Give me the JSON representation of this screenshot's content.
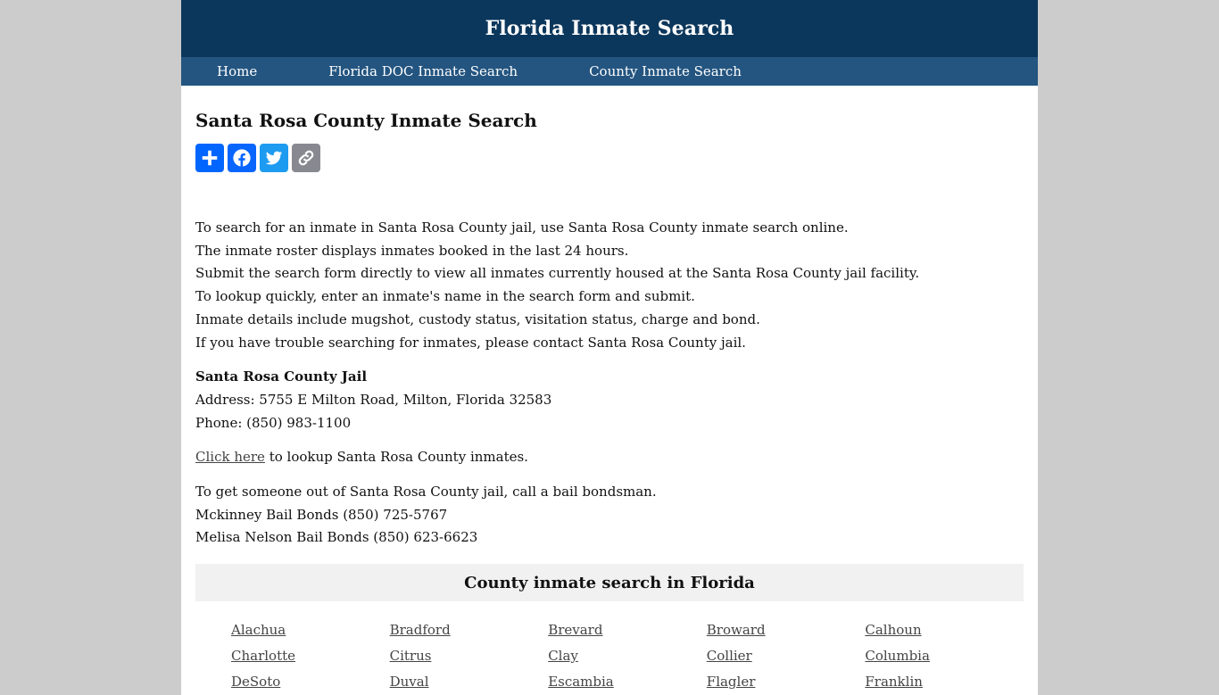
{
  "header": {
    "title": "Florida Inmate Search"
  },
  "nav": {
    "items": [
      {
        "label": "Home"
      },
      {
        "label": "Florida DOC Inmate Search"
      },
      {
        "label": "County Inmate Search"
      }
    ]
  },
  "main": {
    "title": "Santa Rosa County Inmate Search",
    "share_buttons": [
      {
        "icon": "plus-icon",
        "label": "Share"
      },
      {
        "icon": "facebook-icon",
        "label": "Facebook"
      },
      {
        "icon": "twitter-icon",
        "label": "Twitter"
      },
      {
        "icon": "link-icon",
        "label": "Copy Link"
      }
    ],
    "intro_lines": [
      "To search for an inmate in Santa Rosa County jail, use Santa Rosa County inmate search online.",
      "The inmate roster displays inmates booked in the last 24 hours.",
      "Submit the search form directly to view all inmates currently housed at the Santa Rosa County jail facility.",
      "To lookup quickly, enter an inmate's name in the search form and submit.",
      "Inmate details include mugshot, custody status, visitation status, charge and bond.",
      "If you have trouble searching for inmates, please contact Santa Rosa County jail."
    ],
    "jail": {
      "name": "Santa Rosa County Jail",
      "address": "Address: 5755 E Milton Road, Milton, Florida 32583",
      "phone": "Phone: (850) 983-1100"
    },
    "lookup": {
      "link_label": "Click here",
      "text": " to lookup Santa Rosa County inmates."
    },
    "bail": {
      "intro": "To get someone out of Santa Rosa County jail, call a bail bondsman.",
      "bondsmen": [
        "Mckinney Bail Bonds (850) 725-5767",
        "Melisa Nelson Bail Bonds (850) 623-6623"
      ]
    }
  },
  "counties": {
    "heading": "County inmate search in Florida",
    "items": [
      "Alachua",
      "Bradford",
      "Brevard",
      "Broward",
      "Calhoun",
      "Charlotte",
      "Citrus",
      "Clay",
      "Collier",
      "Columbia",
      "DeSoto",
      "Duval",
      "Escambia",
      "Flagler",
      "Franklin"
    ]
  },
  "colors": {
    "header_bg": "#0c375c",
    "nav_bg": "#245580",
    "page_bg": "#cccccc",
    "share_add": "#0166ff",
    "share_facebook": "#0866ff",
    "share_twitter": "#1d9bf0",
    "share_copy": "#888990"
  }
}
